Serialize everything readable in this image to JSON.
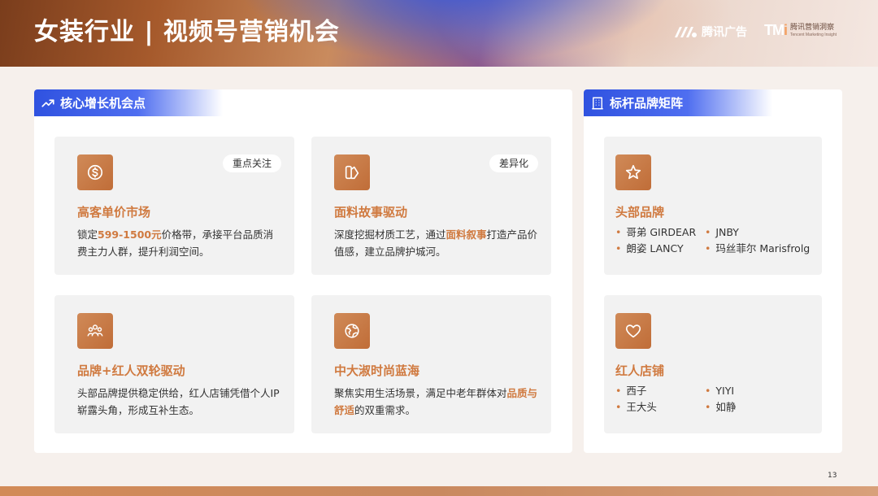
{
  "header": {
    "title": "女装行业 | 视频号营销机会",
    "logo_tencent_ads": "腾讯广告",
    "logo_tmi_mark": "TM",
    "logo_tmi_mark_i": "i",
    "logo_tmi_cn": "腾讯营销洞察",
    "logo_tmi_en": "Tencent Marketing Insight"
  },
  "left_section": {
    "title": "核心增长机会点",
    "icon": "trending-up-icon",
    "cards": [
      {
        "icon": "dollar-coin-icon",
        "badge": "重点关注",
        "title": "高客单价市场",
        "desc_pre": "锁定",
        "desc_hl": "599-1500元",
        "desc_post": "价格带，承接平台品质消费主力人群，提升利润空间。"
      },
      {
        "icon": "fabric-swatch-icon",
        "badge": "差异化",
        "title": "面料故事驱动",
        "desc_pre": "深度挖掘材质工艺，通过",
        "desc_hl": "面料叙事",
        "desc_post": "打造产品价值感，建立品牌护城河。"
      },
      {
        "icon": "people-group-icon",
        "title": "品牌+红人双轮驱动",
        "desc_pre": "头部品牌提供稳定供给，红人店铺凭借个人IP崭露头角，形成互补生态。"
      },
      {
        "icon": "globe-icon",
        "title": "中大淑时尚蓝海",
        "desc_pre": "聚焦实用生活场景，满足中老年群体对",
        "desc_hl": "品质与舒适",
        "desc_post": "的双重需求。"
      }
    ]
  },
  "right_section": {
    "title": "标杆品牌矩阵",
    "icon": "building-icon",
    "cards": [
      {
        "icon": "star-icon",
        "title": "头部品牌",
        "brands": [
          "哥弟 GIRDEAR",
          "JNBY",
          "朗姿 LANCY",
          "玛丝菲尔 Marisfrolg"
        ]
      },
      {
        "icon": "heart-icon",
        "title": "红人店铺",
        "brands": [
          "西子",
          "YIYI",
          "王大头",
          "如静"
        ]
      }
    ]
  },
  "page_number": "13",
  "colors": {
    "accent_orange": "#d07a40",
    "tab_blue": "#2f52e0",
    "card_bg": "#f2f2f2"
  }
}
